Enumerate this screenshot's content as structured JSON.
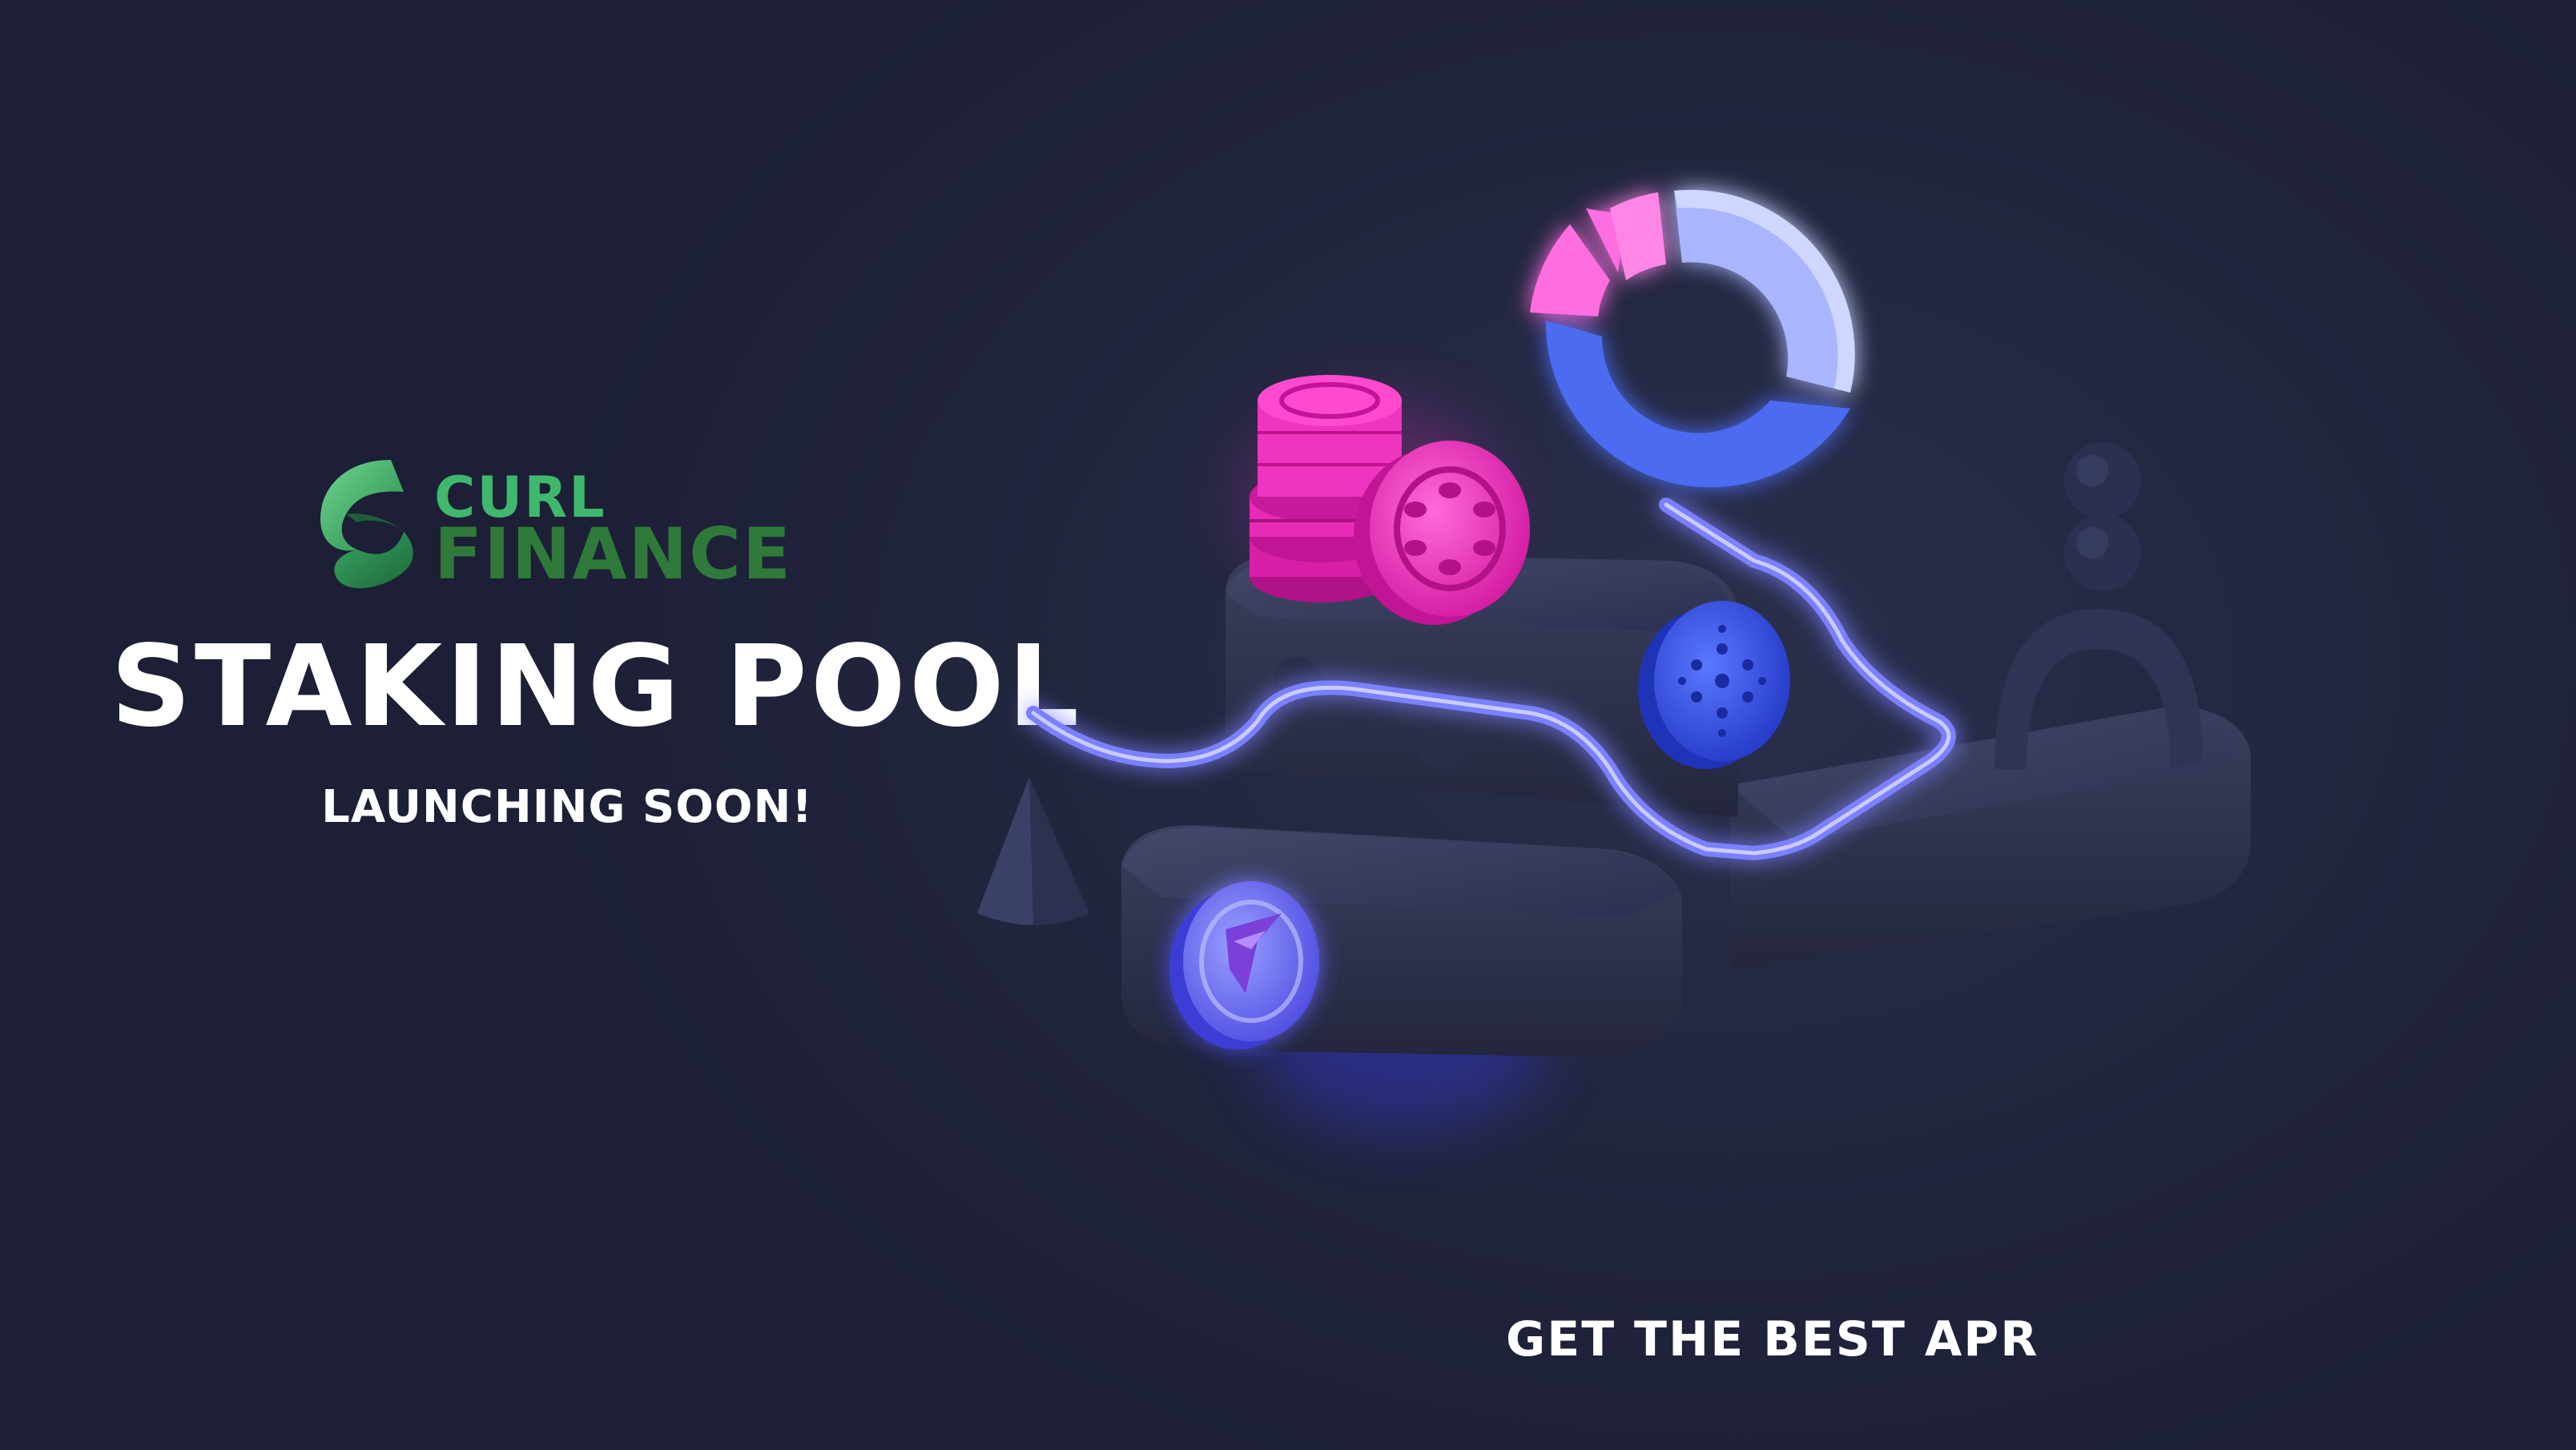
{
  "brand": {
    "line1": "CURL",
    "line2": "FINANCE"
  },
  "headline": "STAKING POOL",
  "subheadline": "LAUNCHING SOON!",
  "tagline": "GET THE BEST APR",
  "colors": {
    "background": "#1e2138",
    "logo_light_green": "#3fb86e",
    "logo_dark_green": "#2f7a3a",
    "text": "#ffffff",
    "neon_blue": "#6f74ff",
    "coin_pink": "#ff2fc6",
    "coin_blue": "#3550e8"
  }
}
